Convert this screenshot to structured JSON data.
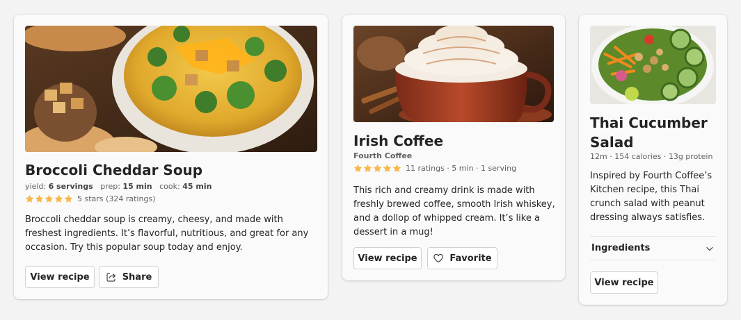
{
  "colors": {
    "background": "#f3f3f3",
    "card": "#fafafa",
    "star": "#f7b84b",
    "text": "#242424",
    "secondary_text": "#616161"
  },
  "cards": [
    {
      "title": "Broccoli Cheddar Soup",
      "image_icon": "broccoli-soup-image",
      "meta": {
        "yield_label": "yield:",
        "yield_value": "6 servings",
        "prep_label": "prep:",
        "prep_value": "15 min",
        "cook_label": "cook:",
        "cook_value": "45 min"
      },
      "stars": 5,
      "rating_text": "5 stars (324 ratings)",
      "description": "Broccoli cheddar soup is creamy, cheesy, and made with freshest ingredients. It’s flavorful, nutritious, and great for any occasion. Try this popular soup today and enjoy.",
      "buttons": {
        "primary": "View recipe",
        "secondary": "Share",
        "secondary_icon": "share-icon"
      }
    },
    {
      "title": "Irish Coffee",
      "image_icon": "irish-coffee-image",
      "subtitle": "Fourth Coffee",
      "stars": 5,
      "rating_text": "11 ratings · 5 min · 1 serving",
      "description": "This rich and creamy drink is made with freshly brewed coffee, smooth Irish whiskey, and a dollop of whipped cream. It’s like a dessert in a mug!",
      "buttons": {
        "primary": "View recipe",
        "secondary": "Favorite",
        "secondary_icon": "heart-icon"
      }
    },
    {
      "title_line1": "Thai Cucumber",
      "title_line2": "Salad",
      "image_icon": "thai-salad-image",
      "meta_text": "12m · 154 calories · 13g protein",
      "description": "Inspired by Fourth Coffee’s Kitchen recipe, this Thai crunch salad with peanut dressing always satisfies.",
      "accordion_label": "Ingredients",
      "accordion_icon": "chevron-down-icon",
      "buttons": {
        "primary": "View recipe"
      }
    }
  ]
}
